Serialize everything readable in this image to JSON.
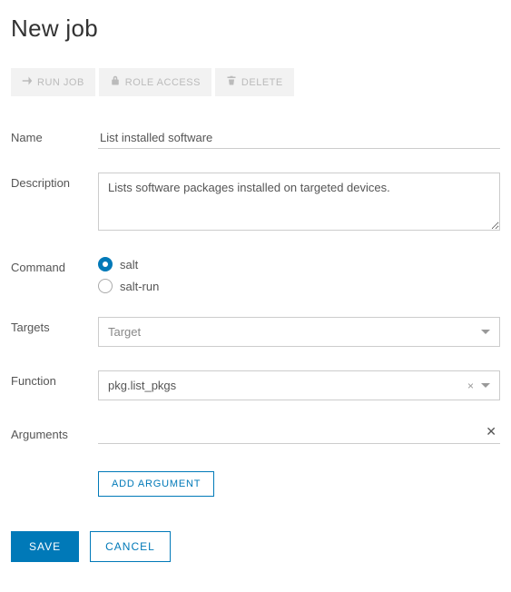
{
  "page_title": "New job",
  "toolbar": {
    "run_job": "RUN JOB",
    "role_access": "ROLE ACCESS",
    "delete": "DELETE"
  },
  "labels": {
    "name": "Name",
    "description": "Description",
    "command": "Command",
    "targets": "Targets",
    "function": "Function",
    "arguments": "Arguments"
  },
  "fields": {
    "name_value": "List installed software",
    "description_value": "Lists software packages installed on targeted devices.",
    "command_options": {
      "salt": "salt",
      "salt_run": "salt-run"
    },
    "command_selected": "salt",
    "target_placeholder": "Target",
    "function_value": "pkg.list_pkgs",
    "arguments": [
      {
        "value": ""
      }
    ]
  },
  "buttons": {
    "add_argument": "ADD ARGUMENT",
    "save": "SAVE",
    "cancel": "CANCEL"
  }
}
